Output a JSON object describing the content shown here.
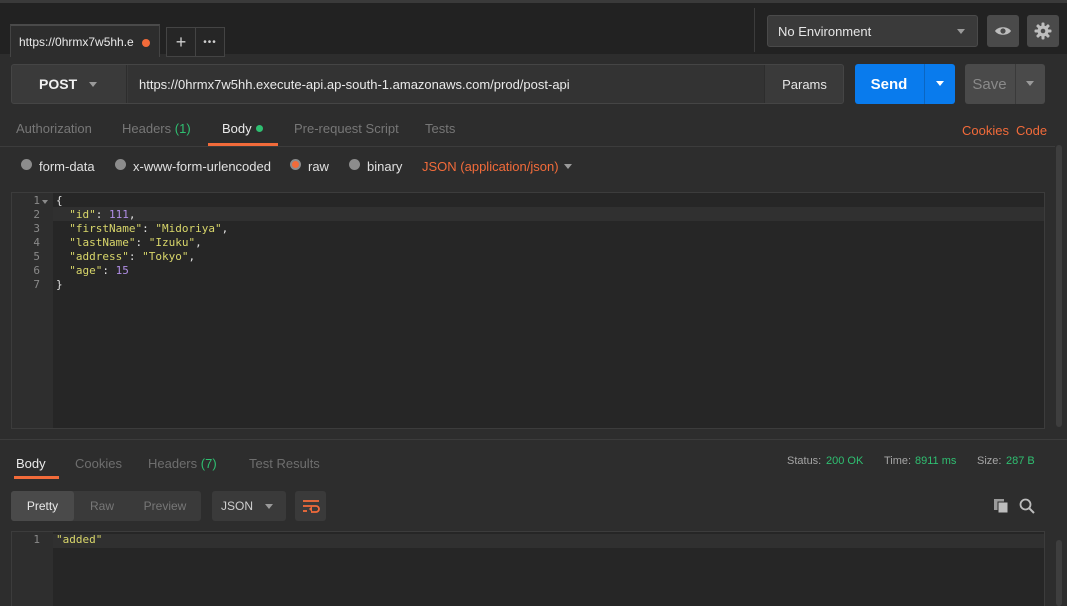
{
  "tab": {
    "title": "https://0hrmx7w5hh.e",
    "new_tab_symbol": "+",
    "more_symbol": "•••"
  },
  "environment": {
    "selected": "No Environment"
  },
  "request": {
    "method": "POST",
    "url": "https://0hrmx7w5hh.execute-api.ap-south-1.amazonaws.com/prod/post-api",
    "params_label": "Params",
    "send_label": "Send",
    "save_label": "Save"
  },
  "request_tabs": {
    "authorization": "Authorization",
    "headers": "Headers",
    "headers_count": "(1)",
    "body": "Body",
    "prerequest": "Pre-request Script",
    "tests": "Tests",
    "cookies": "Cookies",
    "code": "Code"
  },
  "body_modes": {
    "form_data": "form-data",
    "urlencoded": "x-www-form-urlencoded",
    "raw": "raw",
    "binary": "binary",
    "content_type": "JSON (application/json)",
    "selected": "raw"
  },
  "request_body": {
    "line_numbers": [
      "1",
      "2",
      "3",
      "4",
      "5",
      "6",
      "7"
    ],
    "open_brace": "{",
    "close_brace": "}",
    "fields": [
      {
        "key": "\"id\"",
        "value": "111",
        "kind": "number",
        "suffix": ","
      },
      {
        "key": "\"firstName\"",
        "value": "\"Midoriya\"",
        "kind": "string",
        "suffix": ","
      },
      {
        "key": "\"lastName\"",
        "value": "\"Izuku\"",
        "kind": "string",
        "suffix": ","
      },
      {
        "key": "\"address\"",
        "value": "\"Tokyo\"",
        "kind": "string",
        "suffix": ","
      },
      {
        "key": "\"age\"",
        "value": "15",
        "kind": "number",
        "suffix": ""
      }
    ]
  },
  "response_tabs": {
    "body": "Body",
    "cookies": "Cookies",
    "headers": "Headers",
    "headers_count": "(7)",
    "test_results": "Test Results"
  },
  "response_status": {
    "status_label": "Status:",
    "status_value": "200 OK",
    "time_label": "Time:",
    "time_value": "8911 ms",
    "size_label": "Size:",
    "size_value": "287 B"
  },
  "response_view": {
    "pretty": "Pretty",
    "raw": "Raw",
    "preview": "Preview",
    "format": "JSON"
  },
  "response_body": {
    "line_number": "1",
    "content": "\"added\""
  },
  "colors": {
    "accent_orange": "#f26b3a",
    "send_blue": "#097bed",
    "success_green": "#2fbf71"
  }
}
